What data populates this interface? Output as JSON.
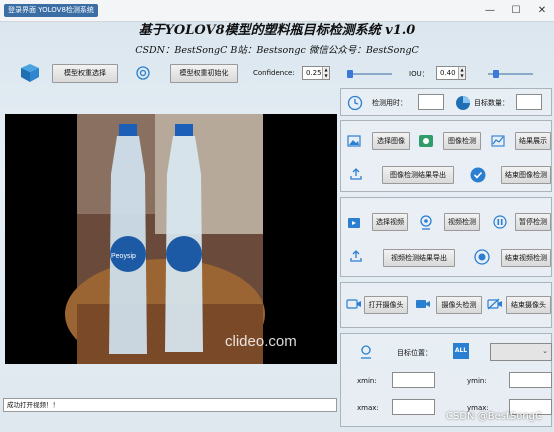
{
  "window": {
    "title": "登录界面 YOLOV8检测系统",
    "min": "—",
    "max": "☐",
    "close": "✕"
  },
  "header": {
    "title": "基于YOLOV8模型的塑料瓶目标检测系统 v1.0",
    "subtitle": "CSDN：BestSongC   B站：Bestsongc   微信公众号：BestSongC"
  },
  "toolbar": {
    "select_weights": "模型权重选择",
    "init_weights": "模型权重初始化",
    "confidence_label": "Confidence:",
    "confidence_value": "0.25",
    "iou_label": "IOU：",
    "iou_value": "0.40",
    "confidence_slider": 0.25,
    "iou_slider": 0.4
  },
  "viewer": {
    "watermark_text": "clideo.com",
    "bottle_label": "Peoysip"
  },
  "status": {
    "text": "成功打开视频！！"
  },
  "stats": {
    "time_label": "检测用时：",
    "time_value": "",
    "count_label": "目标数量：",
    "count_value": ""
  },
  "image_section": {
    "select_image": "选择图像",
    "detect_image": "图像检测",
    "show_result": "结果展示",
    "export_image": "图像检测结果导出",
    "end_image": "结束图像检测"
  },
  "video_section": {
    "select_video": "选择视频",
    "detect_video": "视频检测",
    "pause": "暂停检测",
    "export_video": "视频检测结果导出",
    "end_video": "结束视频检测"
  },
  "camera_section": {
    "open_camera": "打开摄像头",
    "detect_camera": "摄像头检测",
    "close_camera": "结束摄像头"
  },
  "target": {
    "position_label": "目标位置：",
    "all_badge": "ALL",
    "select_value": "",
    "xmin_label": "xmin:",
    "ymin_label": "ymin:",
    "xmax_label": "xmax:",
    "ymax_label": "ymax:"
  },
  "footer_watermark": "CSDN @BestSongC"
}
